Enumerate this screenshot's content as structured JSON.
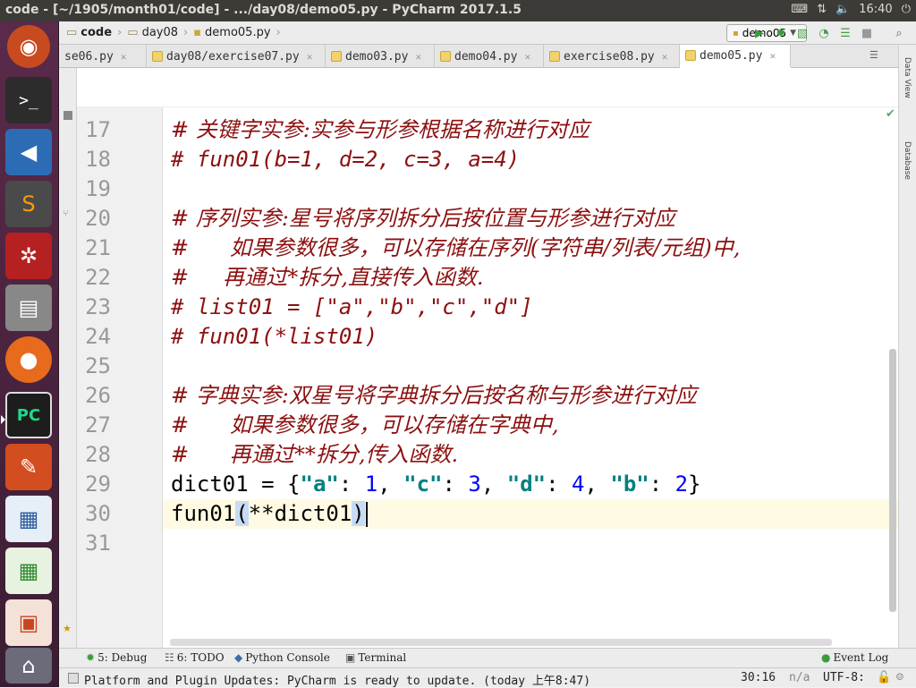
{
  "titlebar": {
    "title": "code - [~/1905/month01/code] - .../day08/demo05.py - PyCharm 2017.1.5",
    "time": "16:40"
  },
  "navbar": {
    "breadcrumbs": [
      "code",
      "day08",
      "demo05.py"
    ],
    "run_config": "demo05"
  },
  "tabs": [
    {
      "label": "se06.py",
      "active": false
    },
    {
      "label": "day08/exercise07.py",
      "active": false
    },
    {
      "label": "demo03.py",
      "active": false
    },
    {
      "label": "demo04.py",
      "active": false
    },
    {
      "label": "exercise08.py",
      "active": false
    },
    {
      "label": "demo05.py",
      "active": true
    }
  ],
  "sidebars": {
    "right_top": "Data View",
    "right_bottom": "Database"
  },
  "editor": {
    "lines": [
      {
        "n": "17",
        "text": "# 关键字实参:实参与形参根据名称进行对应"
      },
      {
        "n": "18",
        "text": "# fun01(b=1, d=2, c=3, a=4)"
      },
      {
        "n": "19",
        "text": ""
      },
      {
        "n": "20",
        "text": "# 序列实参:星号将序列拆分后按位置与形参进行对应"
      },
      {
        "n": "21",
        "text": "#      如果参数很多，可以存储在序列(字符串/列表/元组)中,"
      },
      {
        "n": "22",
        "text": "#     再通过*拆分,直接传入函数."
      },
      {
        "n": "23",
        "text": "# list01 = [\"a\",\"b\",\"c\",\"d\"]"
      },
      {
        "n": "24",
        "text": "# fun01(*list01)"
      },
      {
        "n": "25",
        "text": ""
      },
      {
        "n": "26",
        "text": "# 字典实参:双星号将字典拆分后按名称与形参进行对应"
      },
      {
        "n": "27",
        "text": "#      如果参数很多，可以存储在字典中,"
      },
      {
        "n": "28",
        "text": "#      再通过**拆分,传入函数."
      },
      {
        "n": "29",
        "text": "dict01 = {\"a\": 1, \"c\": 3, \"d\": 4, \"b\": 2}"
      },
      {
        "n": "30",
        "text": "fun01(**dict01)"
      },
      {
        "n": "31",
        "text": ""
      }
    ]
  },
  "toolwindows": {
    "debug": "5: Debug",
    "todo": "6: TODO",
    "console": "Python Console",
    "terminal": "Terminal",
    "eventlog": "Event Log"
  },
  "statusbar": {
    "message": "Platform and Plugin Updates: PyCharm is ready to update. (today 上午8:47)",
    "position": "30:16",
    "na": "n/a",
    "encoding": "UTF-8:"
  }
}
